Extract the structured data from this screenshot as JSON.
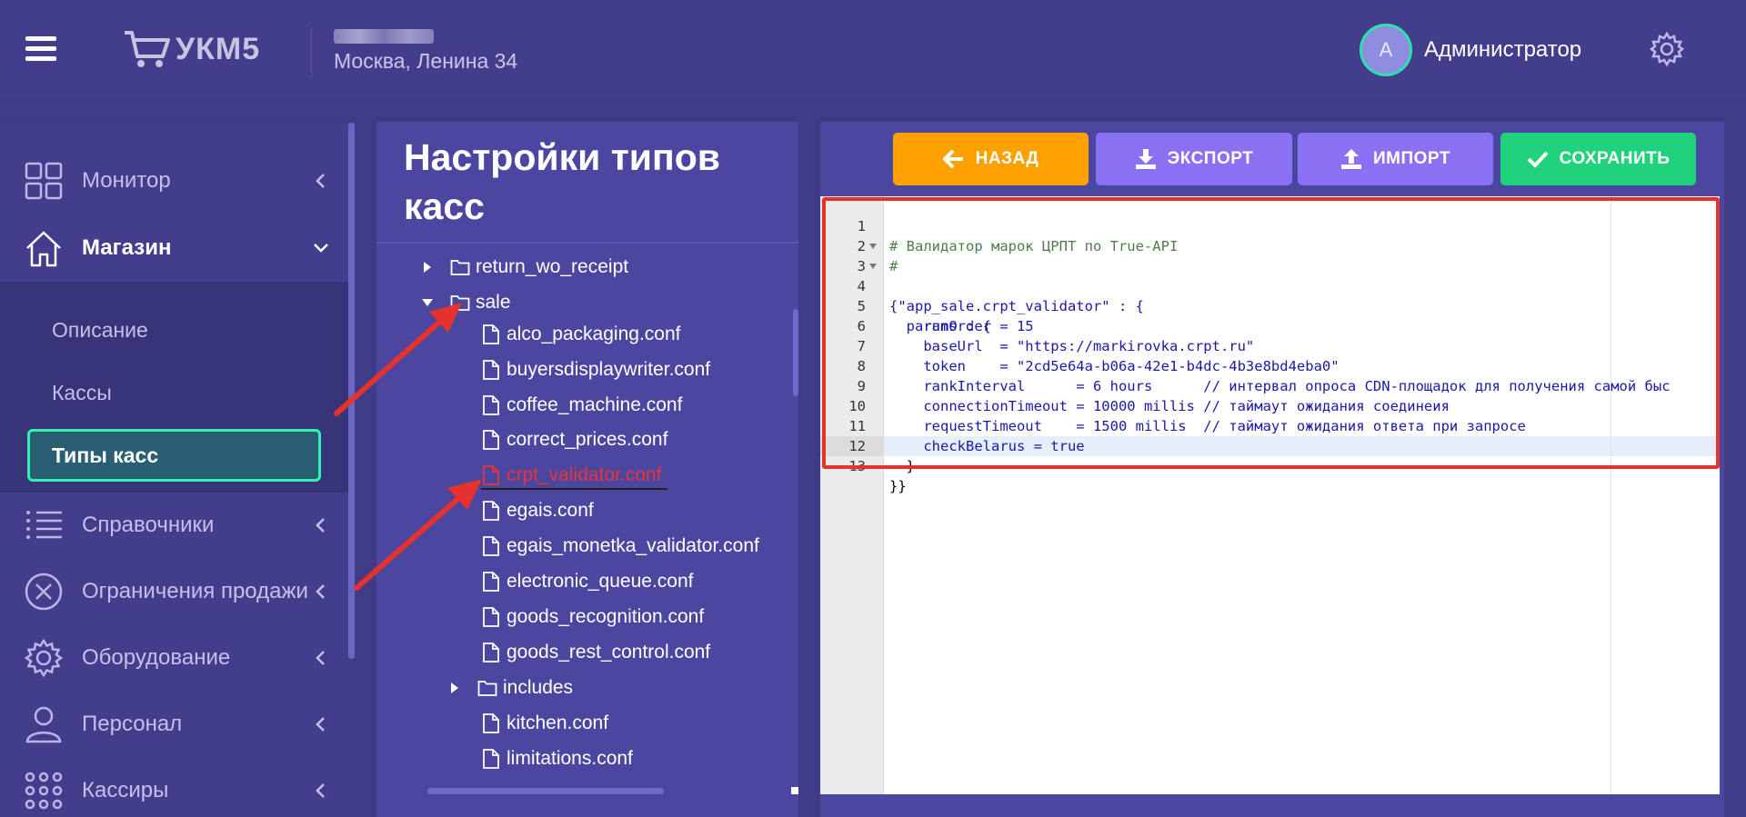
{
  "header": {
    "logo_text": "УКМ5",
    "store_address": "Москва, Ленина 34",
    "user_initial": "A",
    "user_name": "Администратор"
  },
  "sidebar": {
    "items": [
      {
        "label": "Монитор",
        "icon": "grid-icon"
      },
      {
        "label": "Магазин",
        "icon": "house-icon"
      },
      {
        "label": "Справочники",
        "icon": "list-icon"
      },
      {
        "label": "Ограничения продажи",
        "icon": "x-circle-icon"
      },
      {
        "label": "Оборудование",
        "icon": "gear-icon"
      },
      {
        "label": "Персонал",
        "icon": "person-icon"
      },
      {
        "label": "Кассиры",
        "icon": "dots-grid-icon"
      }
    ],
    "submenu": [
      "Описание",
      "Кассы",
      "Типы касс"
    ]
  },
  "middle": {
    "title": "Настройки типов касс",
    "tree": [
      {
        "label": "return_wo_receipt",
        "type": "folder"
      },
      {
        "label": "sale",
        "type": "folder"
      },
      {
        "label": "alco_packaging.conf",
        "type": "file"
      },
      {
        "label": "buyersdisplaywriter.conf",
        "type": "file"
      },
      {
        "label": "coffee_machine.conf",
        "type": "file"
      },
      {
        "label": "correct_prices.conf",
        "type": "file"
      },
      {
        "label": "crpt_validator.conf",
        "type": "file"
      },
      {
        "label": "egais.conf",
        "type": "file"
      },
      {
        "label": "egais_monetka_validator.conf",
        "type": "file"
      },
      {
        "label": "electronic_queue.conf",
        "type": "file"
      },
      {
        "label": "goods_recognition.conf",
        "type": "file"
      },
      {
        "label": "goods_rest_control.conf",
        "type": "file"
      },
      {
        "label": "includes",
        "type": "folder"
      },
      {
        "label": "kitchen.conf",
        "type": "file"
      },
      {
        "label": "limitations.conf",
        "type": "file"
      }
    ]
  },
  "toolbar": {
    "back_label": "НАЗАД",
    "export_label": "ЭКСПОРТ",
    "import_label": "ИМПОРТ",
    "save_label": "СОХРАНИТЬ"
  },
  "editor": {
    "lines": [
      "# Валидатор марок ЦРПТ по True-API",
      "#",
      "{\"app_sale.crpt_validator\" : {",
      "  params : {",
      "    runOrder = 15",
      "    baseUrl  = \"https://markirovka.crpt.ru\"",
      "    token    = \"2cd5e64a-b06a-42e1-b4dc-4b3e8bd4eba0\"",
      "    rankInterval      = 6 hours      // интервал опроса CDN-площадок для получения самой быс",
      "    connectionTimeout = 10000 millis // таймаут ожидания соединеия",
      "    requestTimeout    = 1500 millis  // таймаут ожидания ответа при запросе",
      "    checkBelarus = true",
      "  }",
      "}}"
    ]
  },
  "colors": {
    "accent_green": "#34f0b8",
    "back_button": "#fda000",
    "export_button": "#8a70f3",
    "save_button": "#1fd27b",
    "highlight_red": "#e5322d"
  }
}
